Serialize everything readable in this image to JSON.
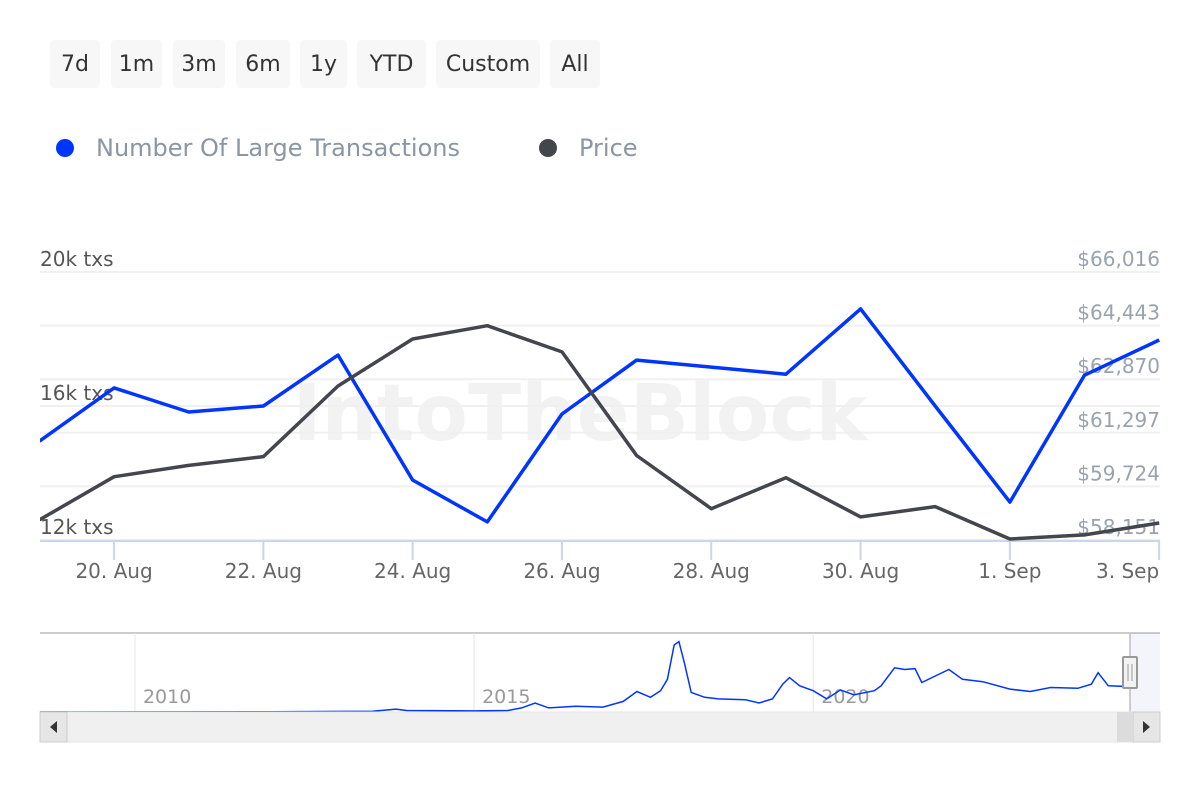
{
  "range_selector": {
    "buttons": [
      "7d",
      "1m",
      "3m",
      "6m",
      "1y",
      "YTD",
      "Custom",
      "All"
    ]
  },
  "legend": {
    "items": [
      {
        "label": "Number Of Large Transactions",
        "color": "#0035ff",
        "icon": "circle"
      },
      {
        "label": "Price",
        "color": "#43474d",
        "icon": "circle"
      }
    ]
  },
  "watermark": "IntoTheBlock",
  "chart_data": {
    "type": "line",
    "x": [
      "19. Aug",
      "20. Aug",
      "21. Aug",
      "22. Aug",
      "23. Aug",
      "24. Aug",
      "25. Aug",
      "26. Aug",
      "27. Aug",
      "28. Aug",
      "29. Aug",
      "30. Aug",
      "31. Aug",
      "1. Sep",
      "2. Sep",
      "3. Sep"
    ],
    "x_tick_labels": [
      "20. Aug",
      "22. Aug",
      "24. Aug",
      "26. Aug",
      "28. Aug",
      "30. Aug",
      "1. Sep",
      "3. Sep"
    ],
    "series": [
      {
        "name": "Number Of Large Transactions",
        "axis": "left",
        "color": "#0035ff",
        "values": [
          14950,
          16540,
          15820,
          16000,
          17520,
          13790,
          12540,
          15760,
          17370,
          17160,
          16950,
          18900,
          16000,
          13130,
          16920,
          17970
        ]
      },
      {
        "name": "Price",
        "axis": "right",
        "color": "#43474d",
        "values": [
          58740,
          60010,
          60340,
          60600,
          62670,
          64050,
          64440,
          63670,
          60630,
          59070,
          59980,
          58830,
          59130,
          58180,
          58300,
          58650
        ]
      }
    ],
    "y_left": {
      "ticks": [
        "20k txs",
        "16k txs",
        "12k txs"
      ],
      "tick_values": [
        20000,
        16000,
        12000
      ],
      "range": [
        12000,
        20000
      ]
    },
    "y_right": {
      "ticks": [
        "$66,016",
        "$64,443",
        "$62,870",
        "$61,297",
        "$59,724",
        "$58,151"
      ],
      "tick_values": [
        66016,
        64443,
        62870,
        61297,
        59724,
        58151
      ],
      "range": [
        58151,
        66016
      ]
    },
    "grid": true,
    "legend_position": "top-left",
    "navigator": {
      "tick_labels": [
        "2010",
        "2015",
        "2020"
      ],
      "tick_values": [
        2010,
        2015,
        2020
      ],
      "range": [
        2008.6,
        2024.67
      ],
      "series": [
        [
          2008.6,
          0
        ],
        [
          2012.0,
          200
        ],
        [
          2013.5,
          400
        ],
        [
          2013.85,
          1800
        ],
        [
          2014.0,
          900
        ],
        [
          2015.0,
          700
        ],
        [
          2015.5,
          900
        ],
        [
          2015.7,
          2500
        ],
        [
          2015.9,
          5500
        ],
        [
          2016.1,
          2500
        ],
        [
          2016.5,
          3500
        ],
        [
          2016.9,
          3000
        ],
        [
          2017.2,
          6500
        ],
        [
          2017.4,
          12500
        ],
        [
          2017.6,
          9000
        ],
        [
          2017.75,
          13000
        ],
        [
          2017.85,
          20000
        ],
        [
          2017.95,
          41000
        ],
        [
          2018.02,
          43000
        ],
        [
          2018.1,
          30000
        ],
        [
          2018.2,
          12000
        ],
        [
          2018.4,
          9000
        ],
        [
          2018.6,
          8000
        ],
        [
          2019.0,
          7500
        ],
        [
          2019.2,
          5500
        ],
        [
          2019.4,
          8000
        ],
        [
          2019.55,
          17000
        ],
        [
          2019.65,
          21000
        ],
        [
          2019.8,
          16000
        ],
        [
          2020.0,
          13000
        ],
        [
          2020.2,
          8000
        ],
        [
          2020.4,
          13500
        ],
        [
          2020.6,
          10500
        ],
        [
          2020.9,
          13000
        ],
        [
          2021.0,
          16000
        ],
        [
          2021.2,
          27000
        ],
        [
          2021.35,
          26000
        ],
        [
          2021.5,
          26500
        ],
        [
          2021.6,
          18000
        ],
        [
          2021.8,
          22000
        ],
        [
          2022.0,
          26000
        ],
        [
          2022.2,
          20000
        ],
        [
          2022.5,
          18500
        ],
        [
          2022.9,
          14000
        ],
        [
          2023.2,
          12500
        ],
        [
          2023.5,
          15000
        ],
        [
          2023.9,
          14500
        ],
        [
          2024.1,
          17000
        ],
        [
          2024.2,
          24000
        ],
        [
          2024.35,
          16000
        ],
        [
          2024.67,
          15500
        ]
      ],
      "y_range": [
        0,
        44000
      ],
      "color": "#0035ff"
    }
  }
}
